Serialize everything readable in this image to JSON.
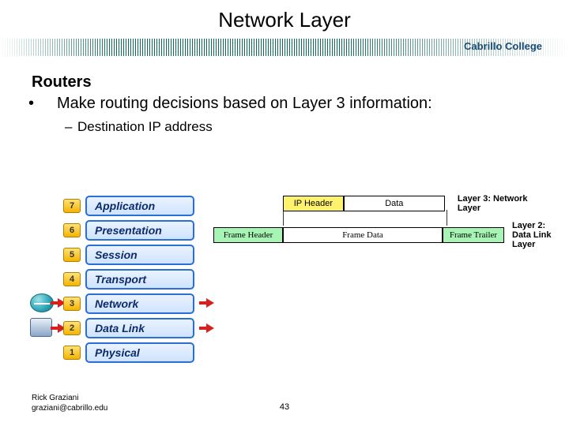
{
  "title": "Network Layer",
  "brand": "Cabrillo College",
  "section_heading": "Routers",
  "bullet_main": "Make routing decisions based on Layer 3 information:",
  "bullet_sub": "Destination IP address",
  "osi": [
    {
      "n": "7",
      "name": "Application"
    },
    {
      "n": "6",
      "name": "Presentation"
    },
    {
      "n": "5",
      "name": "Session"
    },
    {
      "n": "4",
      "name": "Transport"
    },
    {
      "n": "3",
      "name": "Network"
    },
    {
      "n": "2",
      "name": "Data Link"
    },
    {
      "n": "1",
      "name": "Physical"
    }
  ],
  "pkt": {
    "l3": {
      "hdr": "IP Header",
      "data": "Data",
      "label": "Layer 3: Network Layer"
    },
    "l2": {
      "hdr": "Frame Header",
      "data": "Frame Data",
      "trl": "Frame Trailer",
      "label": "Layer 2:\nData Link\nLayer"
    }
  },
  "footer": {
    "author": "Rick Graziani",
    "email": "graziani@cabrillo.edu"
  },
  "page_number": "43"
}
